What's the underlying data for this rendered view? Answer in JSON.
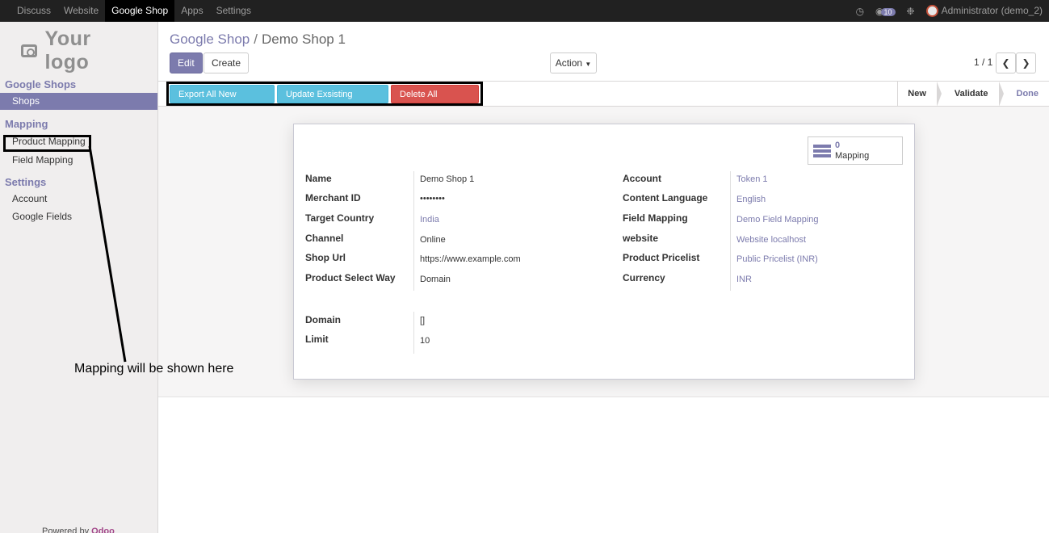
{
  "topbar": {
    "menu": [
      "Discuss",
      "Website",
      "Google Shop",
      "Apps",
      "Settings"
    ],
    "active": "Google Shop",
    "notification_count": "10",
    "user": "Administrator (demo_2)"
  },
  "sidebar": {
    "logo_text": "Your logo",
    "sections": [
      {
        "title": "Google Shops",
        "items": [
          "Shops"
        ]
      },
      {
        "title": "Mapping",
        "items": [
          "Product Mapping",
          "Field Mapping"
        ]
      },
      {
        "title": "Settings",
        "items": [
          "Account",
          "Google Fields"
        ]
      }
    ],
    "powered_prefix": "Powered by",
    "powered_brand": "Odoo"
  },
  "breadcrumb": {
    "parent": "Google Shop",
    "current": "Demo Shop 1"
  },
  "buttons": {
    "edit": "Edit",
    "create": "Create",
    "action": "Action"
  },
  "pager": "1 / 1",
  "statusbar": {
    "export": "Export All New Product",
    "update": "Update Exsisting Product",
    "delete": "Delete All products",
    "stages": [
      "New",
      "Validate",
      "Done"
    ],
    "current_stage": "Done"
  },
  "smart_button": {
    "count": "0",
    "label": "Mapping"
  },
  "form": {
    "left": [
      {
        "label": "Name",
        "value": "Demo Shop 1"
      },
      {
        "label": "Merchant ID",
        "value": "••••••••"
      },
      {
        "label": "Target Country",
        "value": "India"
      },
      {
        "label": "Channel",
        "value": "Online"
      },
      {
        "label": "Shop Url",
        "value": "https://www.example.com"
      },
      {
        "label": "Product Select Way",
        "value": "Domain"
      }
    ],
    "right": [
      {
        "label": "Account",
        "value": "Token 1"
      },
      {
        "label": "Content Language",
        "value": "English"
      },
      {
        "label": "Field Mapping",
        "value": "Demo Field Mapping"
      },
      {
        "label": "website",
        "value": "Website localhost"
      },
      {
        "label": "Product Pricelist",
        "value": "Public Pricelist (INR)"
      },
      {
        "label": "Currency",
        "value": "INR"
      }
    ],
    "bottom": [
      {
        "label": "Domain",
        "value": "[]"
      },
      {
        "label": "Limit",
        "value": "10"
      }
    ]
  },
  "annotation": "Mapping will be shown here",
  "colors": {
    "accent": "#7c7bad",
    "info": "#5bc0de",
    "danger": "#d9534f"
  }
}
